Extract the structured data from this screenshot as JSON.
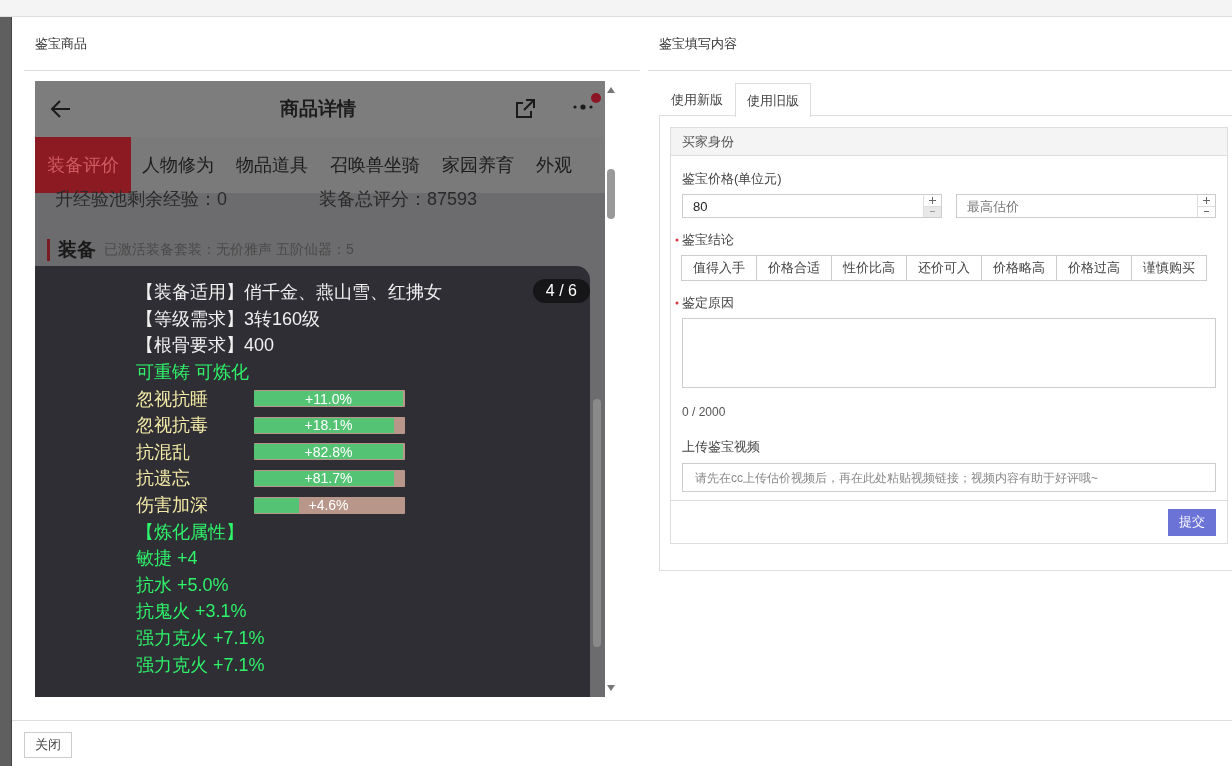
{
  "left_panel": {
    "title": "鉴宝商品",
    "phone": {
      "title": "商品详情",
      "tabs": [
        {
          "label": "装备评价",
          "selected": true
        },
        {
          "label": "人物修为",
          "selected": false
        },
        {
          "label": "物品道具",
          "selected": false
        },
        {
          "label": "召唤兽坐骑",
          "selected": false
        },
        {
          "label": "家园养育",
          "selected": false
        },
        {
          "label": "外观",
          "selected": false
        }
      ],
      "stats": [
        "升经验池剩余经验：0",
        "装备总评分：87593"
      ],
      "section": {
        "title": "装备",
        "note": "已激活装备套装：无价雅声  五阶仙器：5"
      },
      "popup": {
        "counter": "4 / 6",
        "lines": [
          {
            "kind": "info",
            "text": "【装备适用】俏千金、燕山雪、红拂女"
          },
          {
            "kind": "info",
            "text": "【等级需求】3转160级"
          },
          {
            "kind": "info",
            "text": "【根骨要求】400"
          },
          {
            "kind": "green",
            "text": "可重铸 可炼化"
          },
          {
            "kind": "bar",
            "text": "忽视抗睡",
            "value": "+11.0%",
            "level": 1
          },
          {
            "kind": "bar",
            "text": "忽视抗毒",
            "value": "+18.1%",
            "level": 0.93
          },
          {
            "kind": "bar",
            "text": "抗混乱",
            "value": "+82.8%",
            "level": 1
          },
          {
            "kind": "bar",
            "text": "抗遗忘",
            "value": "+81.7%",
            "level": 0.93
          },
          {
            "kind": "bar",
            "text": "伤害加深",
            "value": "+4.6%",
            "level": 0.3
          },
          {
            "kind": "green",
            "text": "【炼化属性】"
          },
          {
            "kind": "green",
            "text": "敏捷 +4"
          },
          {
            "kind": "green",
            "text": "抗水 +5.0%"
          },
          {
            "kind": "green",
            "text": "抗鬼火 +3.1%"
          },
          {
            "kind": "green",
            "text": "强力克火 +7.1%"
          },
          {
            "kind": "green",
            "text": "强力克火 +7.1%"
          }
        ]
      }
    }
  },
  "right_panel": {
    "title": "鉴宝填写内容",
    "tabs": [
      {
        "label": "使用新版",
        "selected": false
      },
      {
        "label": "使用旧版",
        "selected": true
      }
    ],
    "form": {
      "section_title": "买家身份",
      "price_label": "鉴宝价格(单位元)",
      "price_value": "80",
      "max_placeholder": "最高估价",
      "conclusion_label": "鉴宝结论",
      "conclusion_required": true,
      "options": [
        {
          "label": "值得入手",
          "selected": false
        },
        {
          "label": "价格合适",
          "selected": false
        },
        {
          "label": "性价比高",
          "selected": false
        },
        {
          "label": "还价可入",
          "selected": false
        },
        {
          "label": "价格略高",
          "selected": false
        },
        {
          "label": "价格过高",
          "selected": false
        },
        {
          "label": "谨慎购买",
          "selected": false
        }
      ],
      "reason_label": "鉴定原因",
      "reason_required": true,
      "reason_counter": "0 / 2000",
      "video_label": "上传鉴宝视频",
      "video_placeholder": "请先在cc上传估价视频后，再在此处粘贴视频链接；视频内容有助于好评哦~",
      "submit": "提交"
    }
  },
  "footer": {
    "close": "关闭"
  }
}
